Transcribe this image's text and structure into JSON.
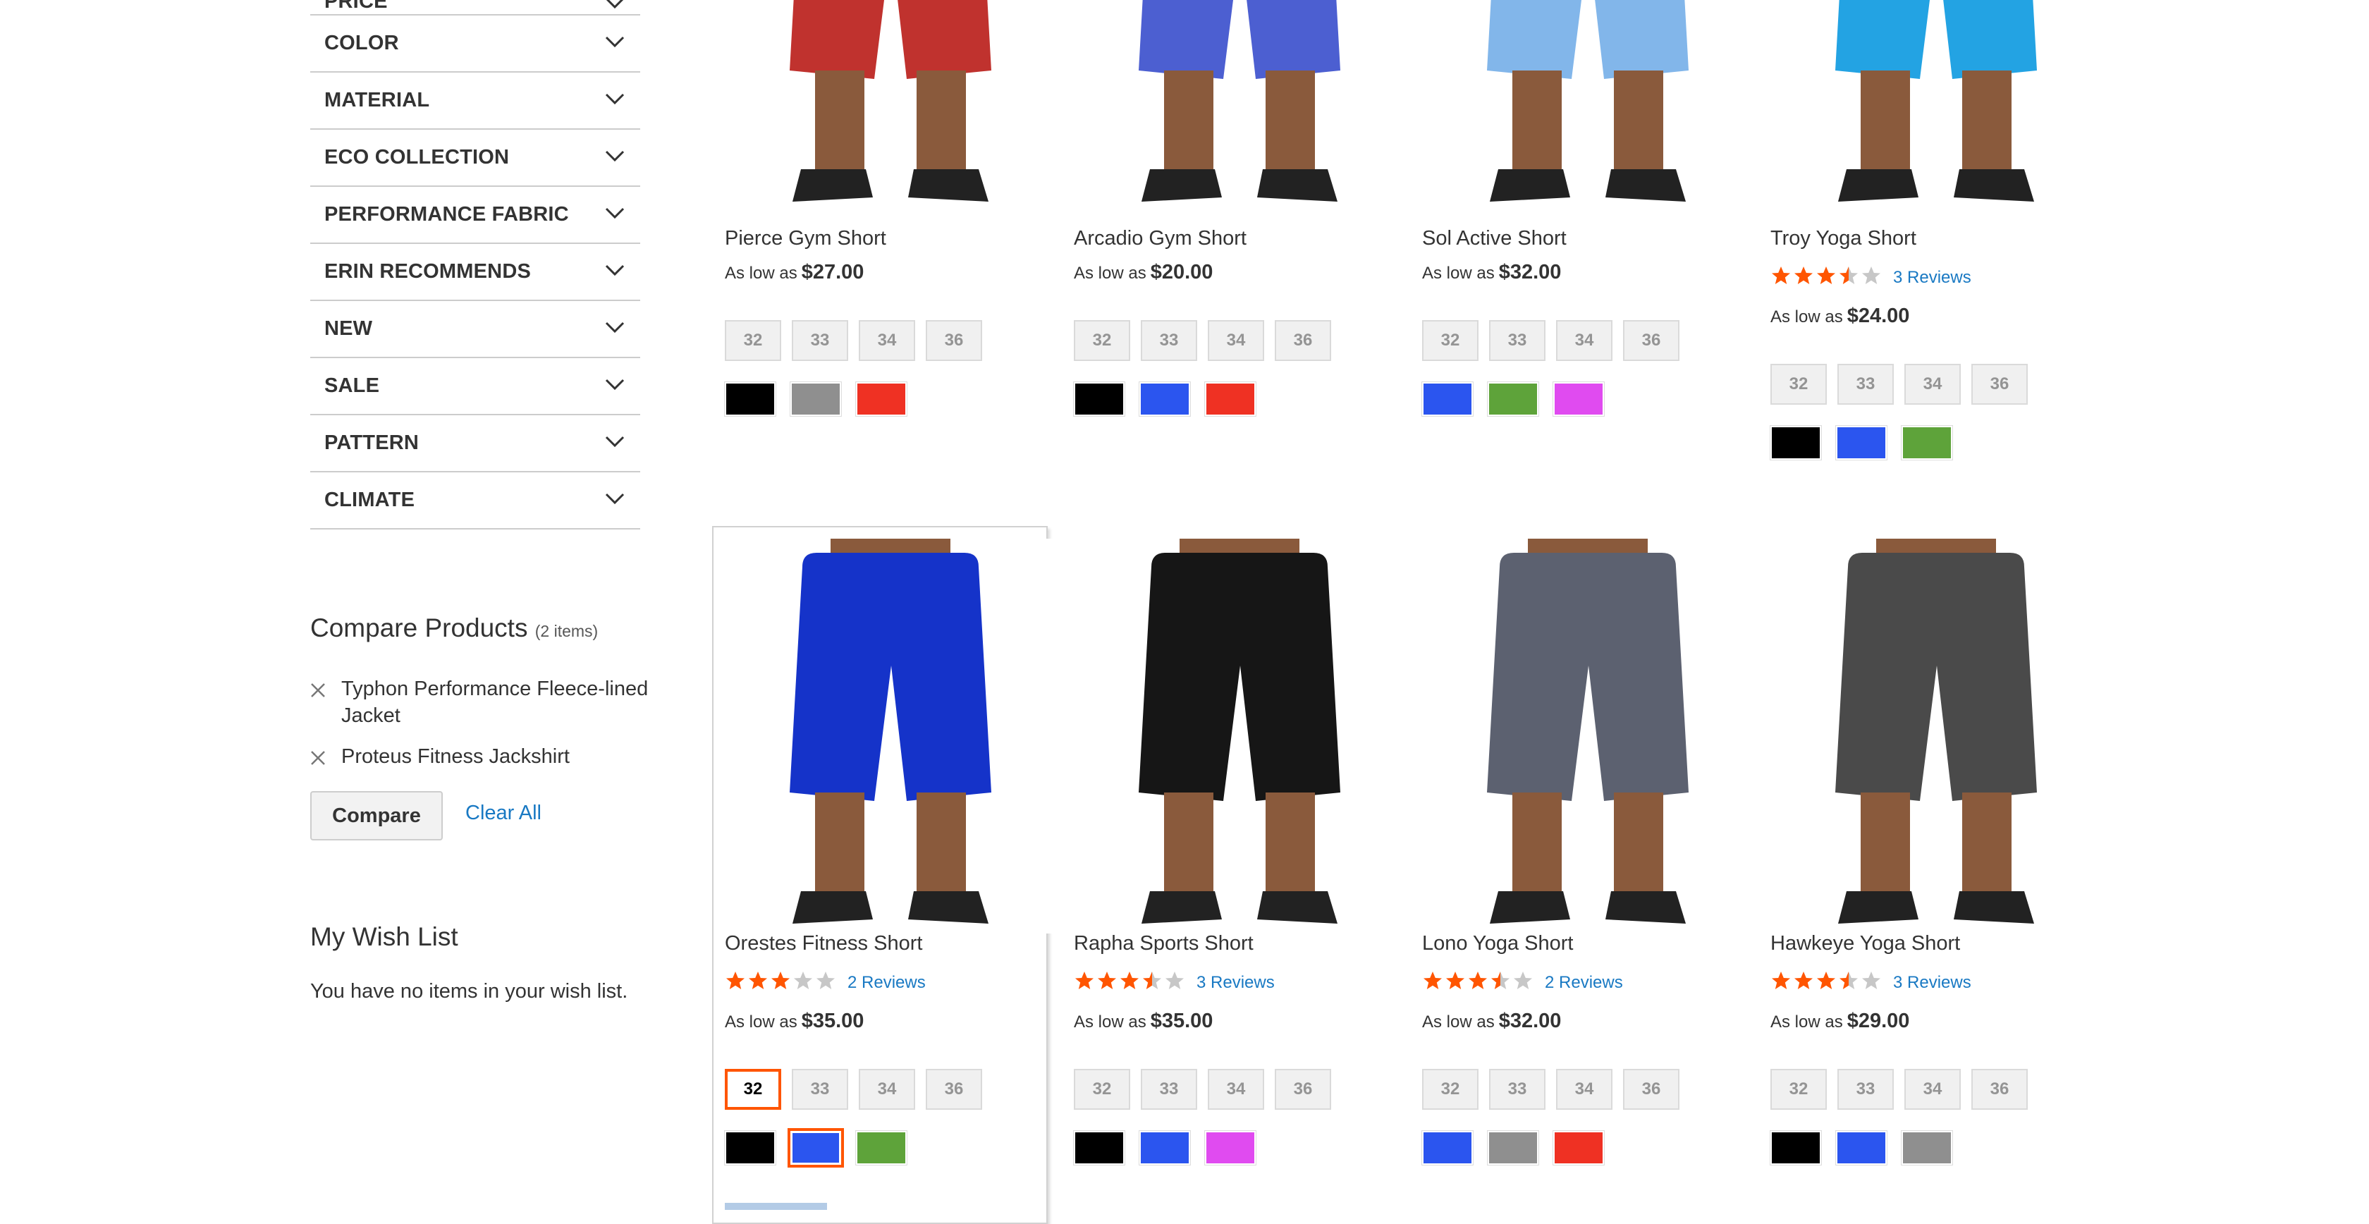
{
  "filters": [
    {
      "label": "PRICE"
    },
    {
      "label": "COLOR"
    },
    {
      "label": "MATERIAL"
    },
    {
      "label": "ECO COLLECTION"
    },
    {
      "label": "PERFORMANCE FABRIC"
    },
    {
      "label": "ERIN RECOMMENDS"
    },
    {
      "label": "NEW"
    },
    {
      "label": "SALE"
    },
    {
      "label": "PATTERN"
    },
    {
      "label": "CLIMATE"
    }
  ],
  "compare": {
    "title": "Compare Products",
    "count": "(2 items)",
    "items": [
      "Typhon Performance Fleece-lined Jacket",
      "Proteus Fitness Jackshirt"
    ],
    "button_label": "Compare",
    "clear_label": "Clear All"
  },
  "wishlist": {
    "title": "My Wish List",
    "empty_text": "You have no items in your wish list."
  },
  "price_prefix": "As low as",
  "colors": {
    "black": "#000000",
    "gray": "#8f8f8f",
    "red": "#ef3123",
    "blue": "#2b55ef",
    "green": "#5ea33a",
    "purple": "#e04bf0",
    "accent": "#ff5501",
    "link": "#1979c3",
    "star": "#ff5501"
  },
  "products": [
    {
      "name": "Pierce Gym Short",
      "price": "$27.00",
      "sizes": [
        "32",
        "33",
        "34",
        "36"
      ],
      "swatches": [
        "black",
        "gray",
        "red"
      ],
      "short_color": "#c0322e"
    },
    {
      "name": "Arcadio Gym Short",
      "price": "$20.00",
      "sizes": [
        "32",
        "33",
        "34",
        "36"
      ],
      "swatches": [
        "black",
        "blue",
        "red"
      ],
      "short_color": "#4c5fd1"
    },
    {
      "name": "Sol Active Short",
      "price": "$32.00",
      "sizes": [
        "32",
        "33",
        "34",
        "36"
      ],
      "swatches": [
        "blue",
        "green",
        "purple"
      ],
      "short_color": "#82b6ea"
    },
    {
      "name": "Troy Yoga Short",
      "price": "$24.00",
      "rating": 3.5,
      "reviews": "3 Reviews",
      "sizes": [
        "32",
        "33",
        "34",
        "36"
      ],
      "swatches": [
        "black",
        "blue",
        "green"
      ],
      "short_color": "#23a3e3"
    },
    {
      "name": "Orestes Fitness Short",
      "price": "$35.00",
      "rating": 3,
      "reviews": "2 Reviews",
      "sizes": [
        "32",
        "33",
        "34",
        "36"
      ],
      "swatches": [
        "black",
        "blue",
        "green"
      ],
      "selected_size": 0,
      "selected_swatch": 1,
      "short_color": "#1533c9"
    },
    {
      "name": "Rapha Sports Short",
      "price": "$35.00",
      "rating": 3.5,
      "reviews": "3 Reviews",
      "sizes": [
        "32",
        "33",
        "34",
        "36"
      ],
      "swatches": [
        "black",
        "blue",
        "purple"
      ],
      "short_color": "#161616"
    },
    {
      "name": "Lono Yoga Short",
      "price": "$32.00",
      "rating": 3.5,
      "reviews": "2 Reviews",
      "sizes": [
        "32",
        "33",
        "34",
        "36"
      ],
      "swatches": [
        "blue",
        "gray",
        "red"
      ],
      "short_color": "#5c6170"
    },
    {
      "name": "Hawkeye Yoga Short",
      "price": "$29.00",
      "rating": 3.5,
      "reviews": "3 Reviews",
      "sizes": [
        "32",
        "33",
        "34",
        "36"
      ],
      "swatches": [
        "black",
        "blue",
        "gray"
      ],
      "short_color": "#4a4a4a"
    }
  ]
}
